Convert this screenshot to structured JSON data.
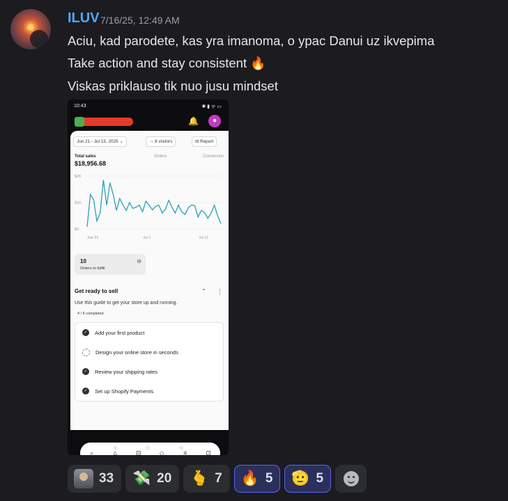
{
  "message": {
    "author": "ILUV",
    "timestamp": "7/16/25, 12:49 AM",
    "lines": [
      "Aciu, kad parodete, kas yra imanoma, o ypac Danui uz ikvepima",
      "Take action and stay consistent",
      "Viskas priklauso tik nuo jusu mindset"
    ],
    "line2_emoji": "🔥"
  },
  "attachment": {
    "status_time": "10:43",
    "status_right": "✱ ▮ ᯤ ▭",
    "filters": {
      "date_range": "Jun 21 - Jul 15, 2025",
      "visitors": "8 visitors",
      "report": "Report"
    },
    "metrics": {
      "total_sales_label": "Total sales",
      "total_sales_value": "$18,956.68",
      "orders_label": "Orders",
      "conversion_label": "Conversion"
    },
    "chart_data": {
      "type": "line",
      "title": "",
      "ylabel": "",
      "xlabel": "",
      "y_ticks": [
        "$2K",
        "$1K",
        "$0"
      ],
      "x_ticks": [
        "Jun 21",
        "Jul 1",
        "Jul 11"
      ],
      "ylim": [
        0,
        2000
      ],
      "series": [
        {
          "values": [
            80,
            1300,
            1100,
            300,
            600,
            1850,
            900,
            1750,
            1300,
            700,
            1150,
            900,
            700,
            1000,
            780,
            820,
            900,
            650,
            1050,
            900,
            720,
            850,
            900,
            600,
            750,
            1080,
            820,
            600,
            900,
            650,
            550,
            800,
            900,
            880,
            450,
            700,
            620,
            400,
            600,
            900,
            500,
            200
          ],
          "color": "#2aa0b5"
        }
      ]
    },
    "orders": {
      "count": "10",
      "label": "Orders to fulfill"
    },
    "guide": {
      "title": "Get ready to sell",
      "subtitle": "Use this guide to get your store up and running.",
      "progress": "4 / 5 completed",
      "tasks": [
        {
          "label": "Add your first product",
          "done": true
        },
        {
          "label": "Design your online store in seconds",
          "done": false
        },
        {
          "label": "Review your shipping rates",
          "done": true
        },
        {
          "label": "Set up Shopify Payments",
          "done": true
        }
      ]
    }
  },
  "reactions": [
    {
      "emoji": "avatar",
      "count": "33",
      "active": false
    },
    {
      "emoji": "💸",
      "count": "20",
      "active": false
    },
    {
      "emoji": "🫰",
      "count": "7",
      "active": false
    },
    {
      "emoji": "🔥",
      "count": "5",
      "active": true
    },
    {
      "emoji": "🫡",
      "count": "5",
      "active": true
    }
  ]
}
